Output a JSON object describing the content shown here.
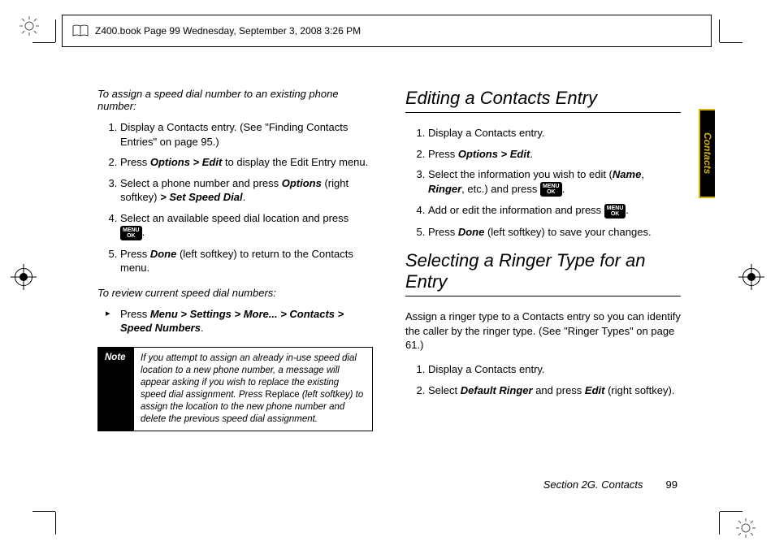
{
  "header": {
    "meta_line": "Z400.book  Page 99  Wednesday, September 3, 2008  3:26 PM"
  },
  "sidebar_tab": "Contacts",
  "left_column": {
    "subhead1": "To assign a speed dial number to an existing phone number:",
    "steps1": {
      "s1": "Display a Contacts entry. (See \"Finding Contacts Entries\" on page 95.)",
      "s2_a": "Press ",
      "s2_b": "Options > Edit",
      "s2_c": " to display the Edit Entry menu.",
      "s3_a": "Select a phone number and press ",
      "s3_b": "Options",
      "s3_c": " (right softkey) ",
      "s3_d": "> Set Speed Dial",
      "s3_e": ".",
      "s4": "Select an available speed dial location and press ",
      "s5_a": "Press ",
      "s5_b": "Done",
      "s5_c": " (left softkey) to return to the Contacts menu."
    },
    "subhead2": "To review current speed dial numbers:",
    "bullet_a": "Press ",
    "bullet_b": "Menu > Settings > More... > Contacts > Speed Numbers",
    "bullet_c": ".",
    "note_label": "Note",
    "note_a": "If you attempt to assign an already in-use speed dial location to a new phone number, a message will appear asking if you wish to replace the existing speed dial assignment. Press ",
    "note_replace": "Replace",
    "note_b": " (left softkey) to assign the location to the new phone number and delete the previous speed dial assignment."
  },
  "right_column": {
    "h2a": "Editing a Contacts Entry",
    "stepsA": {
      "s1": "Display a Contacts entry.",
      "s2_a": "Press ",
      "s2_b": "Options > Edit",
      "s2_c": ".",
      "s3_a": "Select the information you wish to edit (",
      "s3_b": "Name",
      "s3_c": ", ",
      "s3_d": "Ringer",
      "s3_e": ", etc.) and press ",
      "s4": "Add or edit the information and press ",
      "s5_a": "Press ",
      "s5_b": "Done",
      "s5_c": " (left softkey) to save your changes."
    },
    "h2b": "Selecting a Ringer Type for an Entry",
    "para": "Assign a ringer type to a Contacts entry so you can identify the caller by the ringer type. (See \"Ringer Types\" on page 61.)",
    "stepsB": {
      "s1": "Display a Contacts entry.",
      "s2_a": "Select ",
      "s2_b": "Default Ringer",
      "s2_c": " and press ",
      "s2_d": "Edit",
      "s2_e": " (right softkey)."
    }
  },
  "footer": {
    "section": "Section 2G. Contacts",
    "page": "99"
  },
  "icons": {
    "menu_ok_top": "MENU",
    "menu_ok_bottom": "OK"
  }
}
